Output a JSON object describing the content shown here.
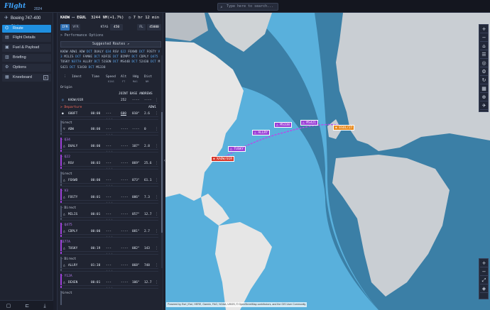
{
  "app": {
    "logo": "Flight Simulator",
    "logo_sub": "2024"
  },
  "search": {
    "placeholder": "Type here to search..."
  },
  "sidebar": {
    "aircraft": "Boeing 747-400 Glob...",
    "items": [
      {
        "label": "Route",
        "icon": "route-icon",
        "active": true
      },
      {
        "label": "Flight Details",
        "icon": "details-icon"
      },
      {
        "label": "Fuel & Payload",
        "icon": "fuel-icon"
      },
      {
        "label": "Briefing",
        "icon": "briefing-icon"
      },
      {
        "label": "Options",
        "icon": "options-icon"
      },
      {
        "label": "Kneeboard",
        "icon": "kneeboard-icon",
        "badge": "K"
      }
    ]
  },
  "route": {
    "origin": "KADW",
    "destination": "EGUL",
    "arrow": "⟷",
    "distance": "3244 NM(+1.7%)",
    "time": "7 hr 12 min",
    "ifr": "IFR",
    "vfr": "VFR",
    "ktas_label": "KTAS",
    "ktas": "450",
    "fl_label": "FL",
    "fl": "45000",
    "perf": "> Performance Options",
    "suggested": "Suggested Routes ↗",
    "string": [
      [
        "KADW",
        ""
      ],
      [
        "ADW1",
        ""
      ],
      [
        "ADW",
        ""
      ],
      [
        "DCT",
        "kw"
      ],
      [
        "DUALY",
        ""
      ],
      [
        "Q34",
        "kw"
      ],
      [
        "RSV",
        ""
      ],
      [
        "Q22",
        "kw"
      ],
      [
        "FOXWD",
        ""
      ],
      [
        "DCT",
        "kw"
      ],
      [
        "FOSTY",
        ""
      ],
      [
        "V3",
        "kw"
      ],
      [
        "MILIS",
        ""
      ],
      [
        "DCT",
        "kw"
      ],
      [
        "FAMHE",
        ""
      ],
      [
        "DCT",
        "kw"
      ],
      [
        "KOFIE",
        ""
      ],
      [
        "DCT",
        "kw"
      ],
      [
        "BIMPY",
        ""
      ],
      [
        "DCT",
        "kw"
      ],
      [
        "CDPLY",
        ""
      ],
      [
        "Q475",
        "kw"
      ],
      [
        "TUSKY",
        ""
      ],
      [
        "N377A",
        "kw"
      ],
      [
        "ALLRY",
        ""
      ],
      [
        "DCT",
        "kw"
      ],
      [
        "51SON",
        ""
      ],
      [
        "DCT",
        "kw"
      ],
      [
        "MS44B",
        ""
      ],
      [
        "DCT",
        "kw"
      ],
      [
        "52430",
        ""
      ],
      [
        "DCT",
        "kw"
      ],
      [
        "MS421",
        ""
      ],
      [
        "DCT",
        "kw"
      ],
      [
        "53430",
        ""
      ],
      [
        "DCT",
        "kw"
      ],
      [
        "MS338",
        ""
      ]
    ]
  },
  "columns": {
    "ident": "Ident",
    "time": "Time",
    "speed": "Speed",
    "speed_sub": "KIAS",
    "alt": "Alt",
    "alt_sub": "FT",
    "hdg": "Hdg",
    "hdg_sub": "MAG",
    "dist": "Dist",
    "dist_sub": "NM"
  },
  "list": {
    "origin_label": "Origin",
    "origin_name": "JOINT BASE ANDREWS",
    "origin_row": {
      "ident": "KADW/01R",
      "time": "",
      "speed": "",
      "alt": "252",
      "hdg": "----",
      "dist": "----"
    },
    "departure_label": "> Departure",
    "departure_name": "ADW1",
    "dep_row": {
      "ident": "600FT",
      "time": "00:00",
      "speed": "---",
      "alt": "600",
      "hdg": "010°",
      "dist": "2.6"
    },
    "groups": [
      {
        "via": "Direct",
        "ident": "ADW",
        "time": "00:00",
        "speed": "---",
        "alt": "----",
        "hdg": "----",
        "dist": "0"
      },
      {
        "via": "> Q34",
        "ident": "DUALY",
        "time": "00:00",
        "speed": "---",
        "alt": "----",
        "hdg": "107°",
        "dist": "2.8"
      },
      {
        "via": "> Q22",
        "ident": "RSV",
        "time": "00:03",
        "speed": "---",
        "alt": "----",
        "hdg": "069°",
        "dist": "25.6"
      },
      {
        "via": "Direct",
        "ident": "FOXWD",
        "time": "00:00",
        "speed": "---",
        "alt": "----",
        "hdg": "073°",
        "dist": "61.1"
      },
      {
        "via": "> V3",
        "ident": "FOSTY",
        "time": "00:01",
        "speed": "---",
        "alt": "----",
        "hdg": "086°",
        "dist": "7.3"
      },
      {
        "via": "> Direct",
        "ident": "MILIS",
        "time": "00:01",
        "speed": "---",
        "alt": "----",
        "hdg": "057°",
        "dist": "12.7"
      },
      {
        "via": "> Q475",
        "ident": "CDPLY",
        "time": "00:00",
        "speed": "---",
        "alt": "----",
        "hdg": "081°",
        "dist": "2.7"
      },
      {
        "via": "N377A",
        "ident": "TUSKY",
        "time": "00:19",
        "speed": "---",
        "alt": "----",
        "hdg": "082°",
        "dist": "143"
      },
      {
        "via": "> Direct",
        "ident": "ALLRY",
        "time": "01:38",
        "speed": "---",
        "alt": "----",
        "hdg": "068°",
        "dist": "748"
      },
      {
        "via": "> Y12A",
        "ident": "DEXEN",
        "time": "00:01",
        "speed": "---",
        "alt": "----",
        "hdg": "106°",
        "dist": "12.7"
      },
      {
        "via": "Direct",
        "ident": "",
        "time": "",
        "speed": "",
        "alt": "",
        "hdg": "",
        "dist": ""
      }
    ]
  },
  "map": {
    "waypoints": [
      {
        "label": "KADW/01R",
        "style": "red"
      },
      {
        "label": "TUSKY",
        "style": "purple"
      },
      {
        "label": "ALLRY",
        "style": "purple"
      },
      {
        "label": "MS338",
        "style": "purple"
      },
      {
        "label": "MS421",
        "style": "purple"
      },
      {
        "label": "EGUL/27",
        "style": "orange"
      }
    ],
    "attribution": "Powered by Esri | Esri, HERE, Garmin, FAO, NOAA, USGS, © OpenStreetMap contributors, and the GIS User Community",
    "colors": {
      "ocean": "#59b0dc",
      "night": "#3b7fa6",
      "land": "#d9d9d9",
      "route": "#9b3fd6"
    }
  },
  "map_tools": [
    "+",
    "−",
    "⌂",
    "☰",
    "◎",
    "⚙",
    "↻",
    "▦",
    "⊕",
    "✈"
  ],
  "map_tools2": [
    "+",
    "−",
    "⤢",
    "◈"
  ]
}
